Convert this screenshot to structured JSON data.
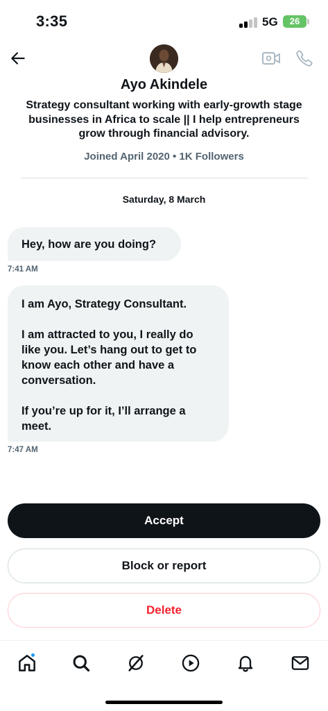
{
  "status_bar": {
    "time": "3:35",
    "network": "5G",
    "battery": "26"
  },
  "header": {
    "back_icon": "arrow-left-icon",
    "video_icon": "video-camera-icon",
    "call_icon": "phone-icon"
  },
  "profile": {
    "name": "Ayo Akindele",
    "bio": "Strategy consultant working with  early-growth stage businesses in Africa to scale  || I help entrepreneurs grow through financial advisory.",
    "meta": "Joined April 2020 • 1K Followers"
  },
  "conversation": {
    "date": "Saturday, 8 March",
    "messages": [
      {
        "paragraphs": [
          "Hey, how are you doing?"
        ],
        "time": "7:41 AM"
      },
      {
        "paragraphs": [
          "I am Ayo, Strategy Consultant.",
          "I am attracted to you, I really do like you. Let’s hang out to get to know each other  and have a conversation.",
          "If you’re up for it, I’ll arrange a meet."
        ],
        "time": "7:47 AM"
      }
    ]
  },
  "actions": {
    "accept": "Accept",
    "block": "Block or report",
    "delete": "Delete"
  },
  "tab_bar": {
    "tabs": [
      {
        "name": "home",
        "icon": "home-icon",
        "has_notification": true
      },
      {
        "name": "search",
        "icon": "search-icon"
      },
      {
        "name": "grok",
        "icon": "grok-icon"
      },
      {
        "name": "video",
        "icon": "play-icon"
      },
      {
        "name": "notifications",
        "icon": "bell-icon"
      },
      {
        "name": "messages",
        "icon": "mail-icon"
      }
    ]
  },
  "colors": {
    "accent": "#1d9bf0",
    "danger": "#f4212e",
    "battery": "#65c466",
    "bubble": "#eff3f4",
    "text": "#0f1419",
    "muted": "#536471"
  }
}
